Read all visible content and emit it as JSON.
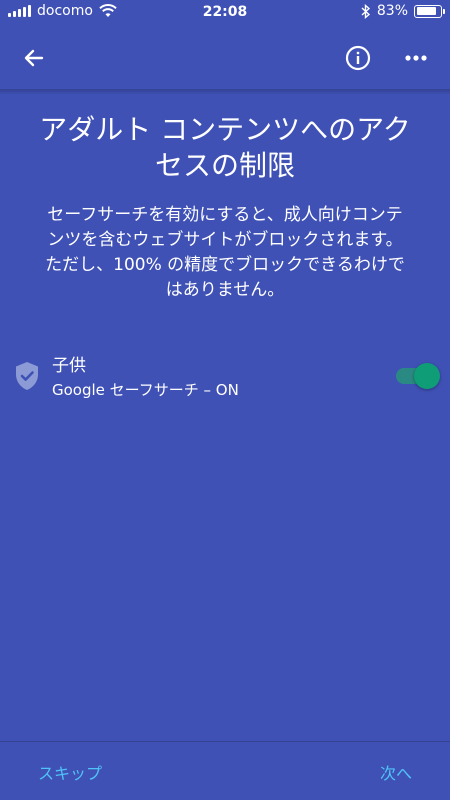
{
  "status_bar": {
    "carrier": "docomo",
    "time": "22:08",
    "battery_percent": "83%",
    "battery_level": 0.83
  },
  "app_bar": {
    "back_icon": "arrow-left-icon",
    "info_icon": "info-icon",
    "more_icon": "more-horizontal-icon"
  },
  "main": {
    "title": "アダルト コンテンツへのアクセスの制限",
    "description": "セーフサーチを有効にすると、成人向けコンテンツを含むウェブサイトがブロックされます。ただし、100% の精度でブロックできるわけではありません。"
  },
  "setting": {
    "icon": "shield-check-icon",
    "title": "子供",
    "subtitle": "Google セーフサーチ – ON",
    "enabled": true
  },
  "footer": {
    "skip_label": "スキップ",
    "next_label": "次へ"
  },
  "colors": {
    "background": "#3f51b5",
    "accent_link": "#4fc3f7",
    "toggle_on": "#0f9d78"
  }
}
